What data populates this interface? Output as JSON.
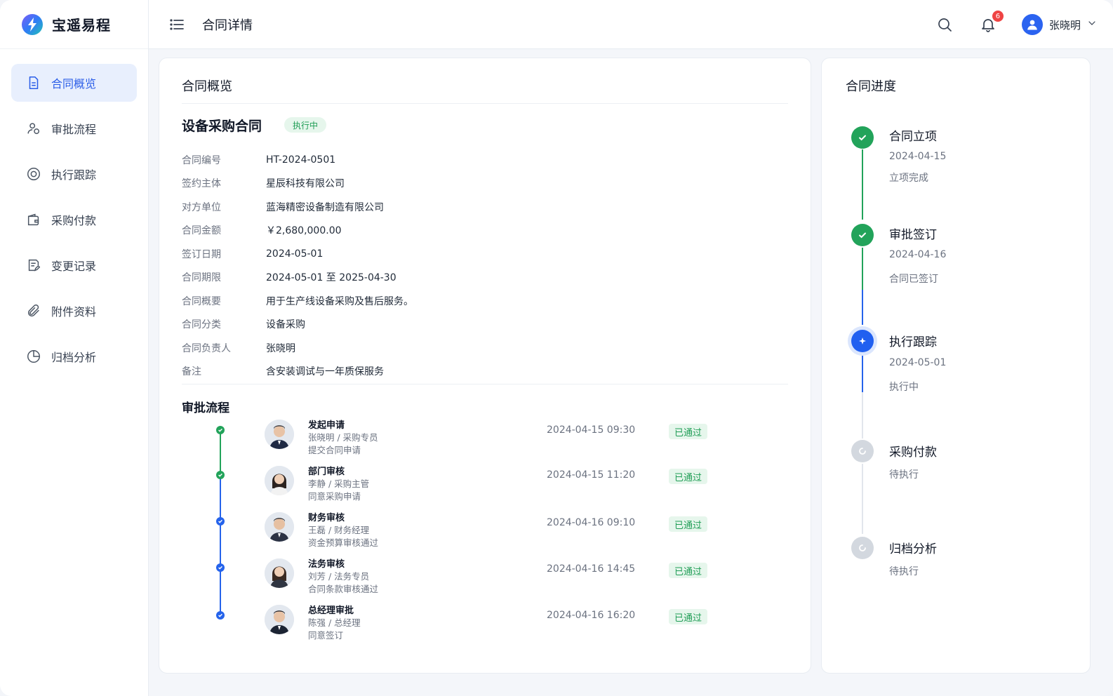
{
  "brand": {
    "name": "宝遥易程",
    "logo_icon": "brand-logo-icon"
  },
  "topbar": {
    "title": "合同详情",
    "notification_count": "6",
    "user_name": "张晓明"
  },
  "sidebar": {
    "items": [
      {
        "label": "合同概览",
        "icon": "document-icon",
        "active": true
      },
      {
        "label": "审批流程",
        "icon": "users-icon",
        "active": false
      },
      {
        "label": "执行跟踪",
        "icon": "target-icon",
        "active": false
      },
      {
        "label": "采购付款",
        "icon": "wallet-icon",
        "active": false
      },
      {
        "label": "变更记录",
        "icon": "edit-doc-icon",
        "active": false
      },
      {
        "label": "附件资料",
        "icon": "paperclip-icon",
        "active": false
      },
      {
        "label": "归档分析",
        "icon": "pie-chart-icon",
        "active": false
      }
    ]
  },
  "overview": {
    "title": "合同概览",
    "contract_name": "设备采购合同",
    "status": "执行中",
    "fields": [
      {
        "label": "合同编号",
        "value": "HT-2024-0501"
      },
      {
        "label": "签约主体",
        "value": "星辰科技有限公司"
      },
      {
        "label": "对方单位",
        "value": "蓝海精密设备制造有限公司"
      },
      {
        "label": "合同金额",
        "value": "￥2,680,000.00"
      },
      {
        "label": "签订日期",
        "value": "2024-05-01"
      },
      {
        "label": "合同期限",
        "value": "2024-05-01 至 2025-04-30"
      },
      {
        "label": "合同概要",
        "value": "用于生产线设备采购及售后服务。"
      },
      {
        "label": "合同分类",
        "value": "设备采购"
      },
      {
        "label": "合同负责人",
        "value": "张晓明"
      },
      {
        "label": "备注",
        "value": "含安装调试与一年质保服务"
      }
    ]
  },
  "approval": {
    "title": "审批流程",
    "steps": [
      {
        "title": "发起申请",
        "person": "张晓明 / 采购专员",
        "note": "提交合同申请",
        "time": "2024-04-15 09:30",
        "status": "已通过",
        "dot_color": "#22a35a",
        "gender": "m"
      },
      {
        "title": "部门审核",
        "person": "李静 / 采购主管",
        "note": "同意采购申请",
        "time": "2024-04-15 11:20",
        "status": "已通过",
        "dot_color": "#22a35a",
        "gender": "f"
      },
      {
        "title": "财务审核",
        "person": "王磊 / 财务经理",
        "note": "资金预算审核通过",
        "time": "2024-04-16 09:10",
        "status": "已通过",
        "dot_color": "#2563eb",
        "gender": "m"
      },
      {
        "title": "法务审核",
        "person": "刘芳 / 法务专员",
        "note": "合同条款审核通过",
        "time": "2024-04-16 14:45",
        "status": "已通过",
        "dot_color": "#2563eb",
        "gender": "f"
      },
      {
        "title": "总经理审批",
        "person": "陈强 / 总经理",
        "note": "同意签订",
        "time": "2024-04-16 16:20",
        "status": "已通过",
        "dot_color": "#2563eb",
        "gender": "m"
      }
    ]
  },
  "progress": {
    "title": "合同进度",
    "stages": [
      {
        "title": "合同立项",
        "date": "2024-04-15",
        "note": "立项完成",
        "state": "done"
      },
      {
        "title": "审批签订",
        "date": "2024-04-16",
        "note": "合同已签订",
        "state": "done"
      },
      {
        "title": "执行跟踪",
        "date": "2024-05-01",
        "note": "执行中",
        "state": "current"
      },
      {
        "title": "采购付款",
        "date": "",
        "note": "待执行",
        "state": "pending"
      },
      {
        "title": "归档分析",
        "date": "",
        "note": "待执行",
        "state": "pending"
      }
    ]
  },
  "colors": {
    "accent": "#2b5ee8",
    "success": "#22a35a",
    "success_bg": "#e6f6ec",
    "pending": "#c9ced6"
  }
}
